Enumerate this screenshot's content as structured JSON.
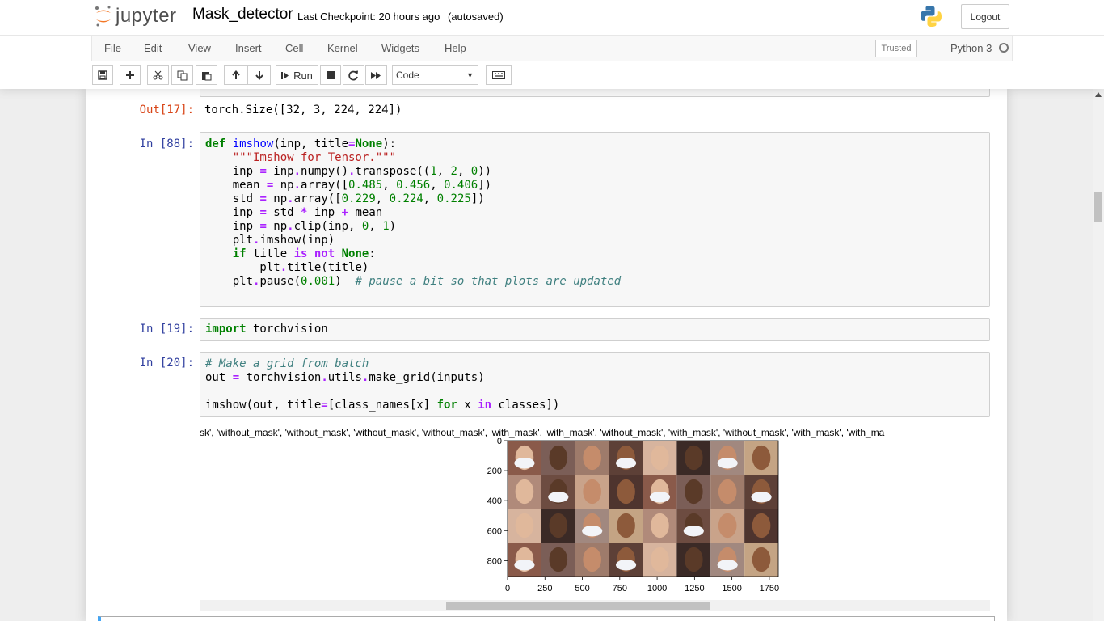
{
  "header": {
    "brand": "jupyter",
    "notebook_name": "Mask_detector",
    "checkpoint": "Last Checkpoint: 20 hours ago",
    "autosave": "(autosaved)",
    "logout_label": "Logout"
  },
  "menubar": {
    "items": [
      "File",
      "Edit",
      "View",
      "Insert",
      "Cell",
      "Kernel",
      "Widgets",
      "Help"
    ],
    "trusted_label": "Trusted",
    "kernel_name": "Python 3"
  },
  "toolbar": {
    "run_label": "Run",
    "cell_type": "Code"
  },
  "cells": {
    "cell17": {
      "out_prompt": "Out[17]:",
      "output": "torch.Size([32, 3, 224, 224])"
    },
    "cell88": {
      "in_prompt": "In [88]:"
    },
    "cell19": {
      "in_prompt": "In [19]:"
    },
    "cell20": {
      "in_prompt": "In [20]:"
    }
  },
  "plot": {
    "title": "sk', 'without_mask', 'without_mask', 'without_mask', 'without_mask', 'with_mask', 'with_mask', 'without_mask', 'with_mask', 'without_mask', 'with_mask', 'with_ma",
    "yticks": [
      "0",
      "200",
      "400",
      "600",
      "800"
    ],
    "xticks": [
      "0",
      "250",
      "500",
      "750",
      "1000",
      "1250",
      "1500",
      "1750"
    ]
  },
  "colors": {
    "in_prompt": "#303f9f",
    "out_prompt": "#d84315",
    "keyword": "#008000",
    "string": "#ba2121",
    "comment": "#408080"
  }
}
